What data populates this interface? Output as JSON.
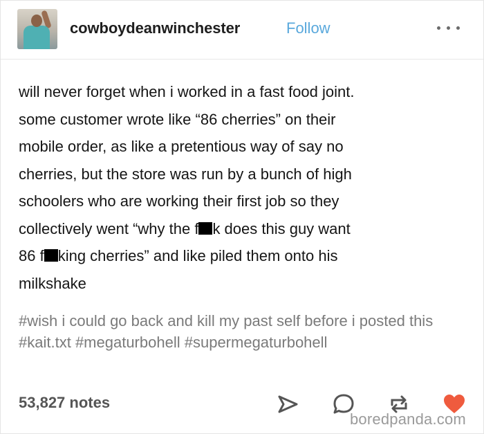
{
  "post": {
    "username": "cowboydeanwinchester",
    "follow_label": "Follow",
    "body": {
      "line1": "will never forget when i worked in a fast food joint.",
      "line2": "some customer wrote like “86 cherries” on their",
      "line3": "mobile order, as like a pretentious way of say no",
      "line4": "cherries, but the store was run by a bunch of high",
      "line5": "schoolers who are working their first job so they",
      "line6_a": "collectively went “why the f",
      "line6_b": "k does this guy want",
      "line7_a": "86 f",
      "line7_b": "king cherries” and like piled them onto his",
      "line8": "milkshake"
    },
    "tags": {
      "tag1": "#wish i could go back and kill my past self before i posted this",
      "tag2": "#kait.txt",
      "tag3": "#megaturbohell",
      "tag4": "#supermegaturbohell"
    },
    "notes_label": "53,827 notes",
    "watermark": "boredpanda.com"
  },
  "icons": {
    "avatar": "avatar",
    "more": "more-options-icon",
    "share": "share-icon",
    "reply": "reply-icon",
    "reblog": "reblog-icon",
    "like": "heart-icon"
  },
  "colors": {
    "follow": "#59a8dc",
    "tags": "#7a7a7a",
    "notes": "#555555",
    "icons": "#555555",
    "heart": "#ef5b3e"
  }
}
